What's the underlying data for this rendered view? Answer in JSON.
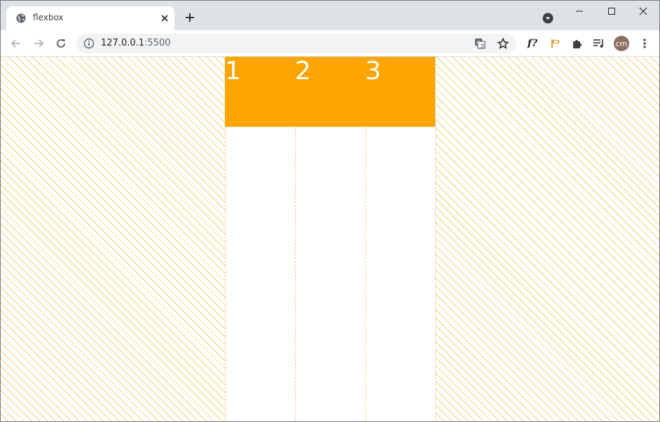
{
  "browser": {
    "tab": {
      "title": "flexbox"
    },
    "new_tab_label": "+",
    "window_controls": {
      "minimize": "—",
      "maximize": "☐",
      "close": "✕"
    },
    "address": {
      "host": "127.0.0.1",
      "port": ":5500"
    },
    "extensions": {
      "fx_label": "f?"
    },
    "profile": {
      "initials": "cm"
    }
  },
  "page": {
    "items": [
      {
        "label": "1"
      },
      {
        "label": "2"
      },
      {
        "label": "3"
      }
    ],
    "colors": {
      "item_background": "#ffa500",
      "item_text": "#ffffff",
      "stripe": "#f0be46"
    }
  }
}
